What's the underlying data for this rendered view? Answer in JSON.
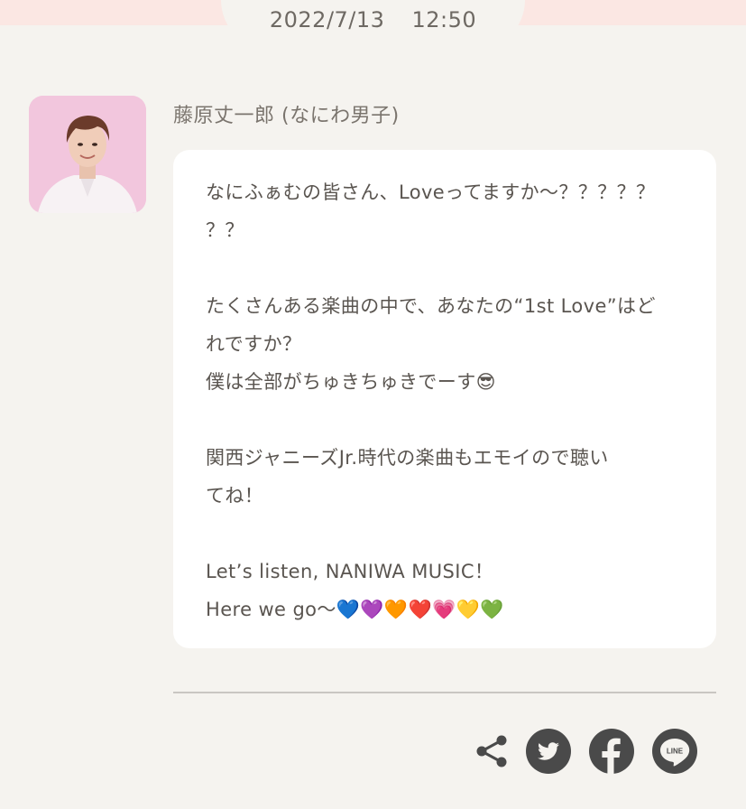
{
  "header": {
    "date": "2022/7/13",
    "time": "12:50"
  },
  "author": {
    "name": "藤原丈一郎 (なにわ男子)",
    "avatar_icon": "person-photo"
  },
  "message": {
    "lines": [
      "なにふぁむの皆さん、Loveってますか〜？？？？？",
      "？？",
      "",
      "たくさんある楽曲の中で、あなたの“1st Love”はど",
      "れですか？",
      "僕は全部がちゅきちゅきでーす😎",
      "",
      "関西ジャニーズJr.時代の楽曲もエモイので聴い",
      "てね！",
      "",
      "Let’s listen, NANIWA MUSIC！",
      "Here we go〜💙💜🧡❤️💗💛💚"
    ]
  },
  "share": {
    "buttons": [
      {
        "name": "share-icon",
        "label": "share"
      },
      {
        "name": "twitter-icon",
        "label": "twitter"
      },
      {
        "name": "facebook-icon",
        "label": "facebook"
      },
      {
        "name": "line-icon",
        "label": "LINE"
      }
    ],
    "icon_color": "#4a4a4a"
  },
  "colors": {
    "background": "#f5f3ef",
    "header_strip": "#fbe7e3",
    "bubble": "#ffffff",
    "text": "#5a5550"
  }
}
